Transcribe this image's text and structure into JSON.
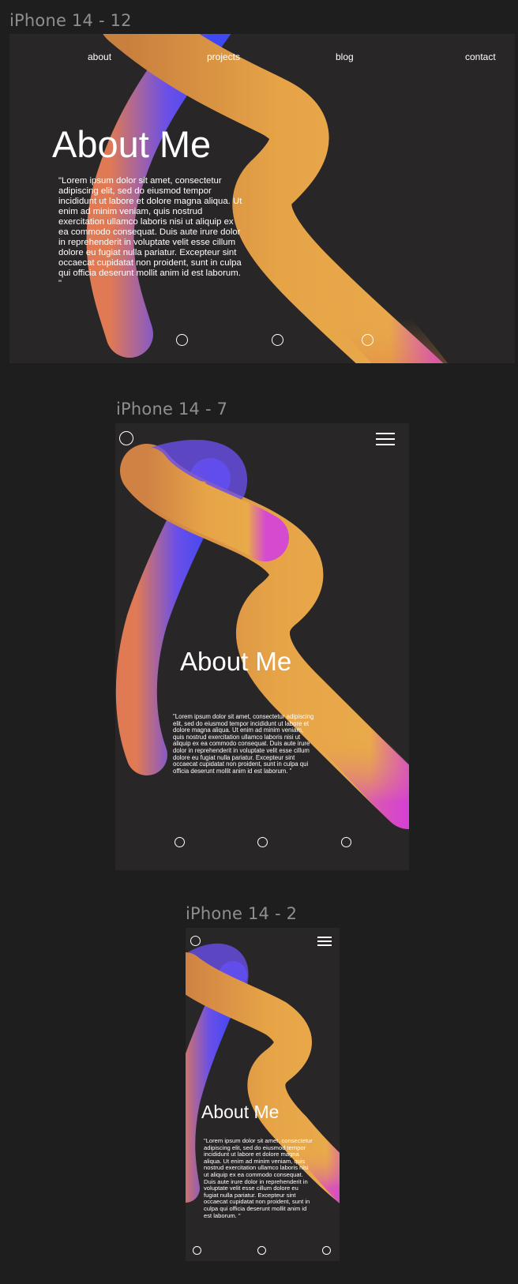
{
  "frames": {
    "desktop": {
      "label": "iPhone 14 - 12",
      "nav": [
        "about",
        "projects",
        "blog",
        "contact"
      ],
      "title": "About Me",
      "body": "\"Lorem ipsum dolor sit amet, consectetur adipiscing elit, sed do eiusmod tempor incididunt ut labore et dolore magna aliqua. Ut enim ad minim veniam, quis nostrud exercitation ullamco laboris nisi ut aliquip ex ea commodo consequat. Duis aute irure dolor in reprehenderit in voluptate velit esse cillum dolore eu fugiat nulla pariatur. Excepteur sint occaecat cupidatat non proident, sunt in culpa qui officia deserunt mollit anim id est laborum. \""
    },
    "tablet": {
      "label": "iPhone 14 - 7",
      "title": "About Me",
      "body": "\"Lorem ipsum dolor sit amet, consectetur adipiscing elit, sed do eiusmod tempor incididunt ut labore et dolore magna aliqua. Ut enim ad minim veniam, quis nostrud exercitation ullamco laboris nisi ut aliquip ex ea commodo consequat. Duis aute irure dolor in reprehenderit in voluptate velit esse cillum dolore eu fugiat nulla pariatur. Excepteur sint occaecat cupidatat non proident, sunt in culpa qui officia deserunt mollit anim id est laborum. \""
    },
    "phone": {
      "label": "iPhone 14 - 2",
      "title": "About Me",
      "body": "\"Lorem ipsum dolor sit amet, consectetur adipiscing elit, sed do eiusmod tempor incididunt ut labore et dolore magna aliqua. Ut enim ad minim veniam, quis nostrud exercitation ullamco laboris nisi ut aliquip ex ea commodo consequat. Duis aute irure dolor in reprehenderit in voluptate velit esse cillum dolore eu fugiat nulla pariatur. Excepteur sint occaecat cupidatat non proident, sunt in culpa qui officia deserunt mollit anim id est laborum. \""
    }
  },
  "colors": {
    "canvas": "#1e1e1e",
    "frame": "#282627",
    "label": "#8f8f8f",
    "text": "#ffffff",
    "gradient_orange": "#e8a443",
    "gradient_blue": "#4a4cf5",
    "gradient_magenta": "#d43ad8"
  },
  "icons": [
    "hamburger-icon",
    "circle-icon"
  ]
}
